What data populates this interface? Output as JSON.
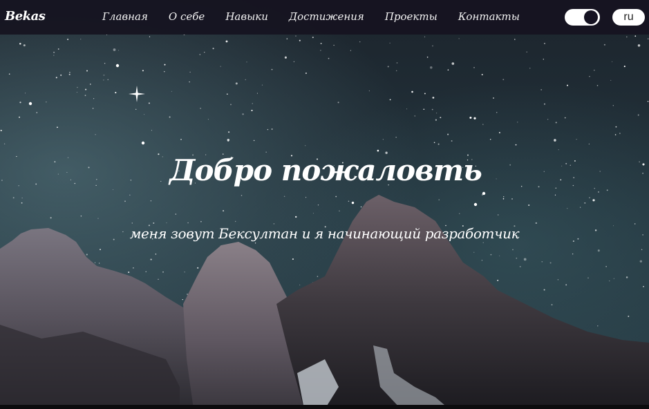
{
  "navbar": {
    "logo": "Bekas",
    "links": [
      {
        "label": "Главная"
      },
      {
        "label": "О себе"
      },
      {
        "label": "Навыки"
      },
      {
        "label": "Достижения"
      },
      {
        "label": "Проекты"
      },
      {
        "label": "Контакты"
      }
    ],
    "theme_toggle": {
      "state": "on"
    },
    "language_button": "ru"
  },
  "hero": {
    "title": "Добро пожаловть",
    "subtitle": "меня зовут Бексултан и я начинающий разработчик"
  },
  "colors": {
    "navbar_bg": "#161320",
    "text": "#ffffff",
    "sky_top": "#1e2830",
    "sky_glow": "#3a5a66",
    "mountain": "#5a5560"
  }
}
